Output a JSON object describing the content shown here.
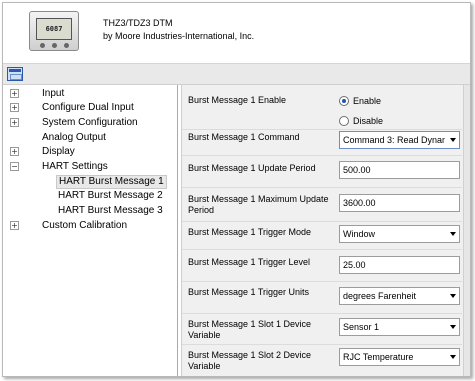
{
  "header": {
    "device_display": "6087",
    "title": "THZ3/TDZ3 DTM",
    "subtitle": "by Moore Industries-International, Inc."
  },
  "toolbar": {
    "icons": [
      "window-icon"
    ]
  },
  "tree": {
    "items": [
      {
        "label": "Input",
        "expander": "+"
      },
      {
        "label": "Configure Dual Input",
        "expander": "+"
      },
      {
        "label": "System Configuration",
        "expander": "+"
      },
      {
        "label": "Analog Output",
        "expander": ""
      },
      {
        "label": "Display",
        "expander": "+"
      },
      {
        "label": "HART Settings",
        "expander": "−"
      },
      {
        "label": "HART Burst Message 1",
        "expander": ""
      },
      {
        "label": "HART Burst Message 2",
        "expander": ""
      },
      {
        "label": "HART Burst Message 3",
        "expander": ""
      },
      {
        "label": "Custom Calibration",
        "expander": "+"
      }
    ],
    "selected": "HART Burst Message 1"
  },
  "panel": {
    "enable": {
      "label": "Burst Message 1 Enable",
      "options": [
        "Enable",
        "Disable"
      ],
      "selected": "Enable"
    },
    "command": {
      "label": "Burst Message 1 Command",
      "value": "Command 3: Read Dynami"
    },
    "update_period": {
      "label": "Burst Message 1 Update Period",
      "value": "500.00"
    },
    "max_update_period": {
      "label": "Burst Message 1 Maximum Update Period",
      "value": "3600.00"
    },
    "trigger_mode": {
      "label": "Burst Message 1 Trigger Mode",
      "value": "Window"
    },
    "trigger_level": {
      "label": "Burst Message 1 Trigger Level",
      "value": "25.00"
    },
    "trigger_units": {
      "label": "Burst Message 1 Trigger Units",
      "value": "degrees Farenheit"
    },
    "slot1": {
      "label": "Burst Message 1 Slot 1 Device Variable",
      "value": "Sensor 1"
    },
    "slot2": {
      "label": "Burst Message 1 Slot 2 Device Variable",
      "value": "RJC Temperature"
    }
  },
  "colors": {
    "radio_selected": "#1f56b5",
    "toolbar_bg": "#e9e9e9",
    "panel_bg": "#f0f0f0"
  }
}
